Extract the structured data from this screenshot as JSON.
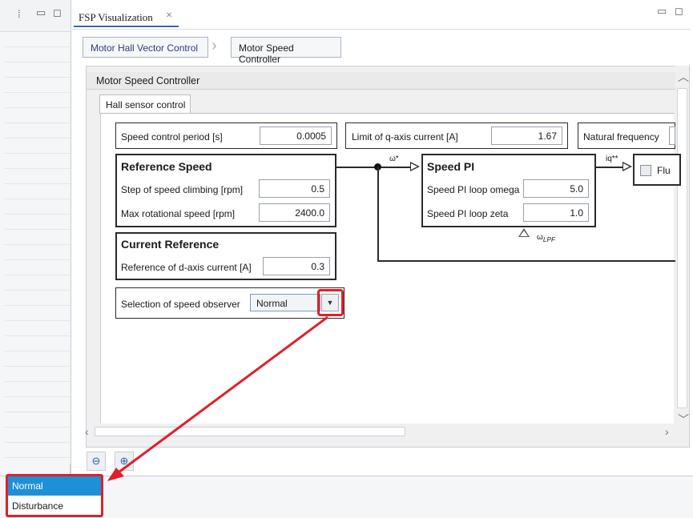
{
  "left_panel": {
    "icons": [
      "drag-handle-icon",
      "minimize-icon",
      "maximize-icon"
    ]
  },
  "tab": {
    "title": "FSP Visualization",
    "close": "×"
  },
  "window_controls": {
    "minimize": "—",
    "maximize": "□"
  },
  "breadcrumb": {
    "items": [
      "Motor Hall Vector Control",
      "Motor Speed Controller"
    ],
    "separator": "›"
  },
  "editor": {
    "title": "Motor Speed Controller",
    "subtab": "Hall sensor control",
    "speed_control_period": {
      "label": "Speed control period [s]",
      "value": "0.0005"
    },
    "limit_q_current": {
      "label": "Limit of q-axis current [A]",
      "value": "1.67"
    },
    "natural_frequency": {
      "label": "Natural frequency"
    },
    "reference_speed": {
      "title": "Reference Speed",
      "step_label": "Step of speed climbing [rpm]",
      "step_value": "0.5",
      "max_label": "Max rotational speed [rpm]",
      "max_value": "2400.0"
    },
    "current_reference": {
      "title": "Current Reference",
      "d_label": "Reference of d-axis current [A]",
      "d_value": "0.3"
    },
    "speed_observer": {
      "label": "Selection of speed observer",
      "selected": "Normal",
      "arrow": "▼"
    },
    "speed_pi": {
      "title": "Speed PI",
      "omega_label": "Speed PI loop omega",
      "omega_value": "5.0",
      "zeta_label": "Speed PI loop zeta",
      "zeta_value": "1.0"
    },
    "signals": {
      "omega_star": "ω*",
      "iq_star": "iq**",
      "omega_lpf": "ω",
      "omega_lpf_sub": "LPF"
    },
    "flux_label": "Flu"
  },
  "zoom": {
    "zoom_out": "⊖",
    "zoom_in": "⊕"
  },
  "dropdown": {
    "options": [
      "Normal",
      "Disturbance"
    ],
    "selected_index": 0
  },
  "colors": {
    "highlight": "#e0202a",
    "selection": "#1e90d6",
    "accent": "#3566b3"
  }
}
